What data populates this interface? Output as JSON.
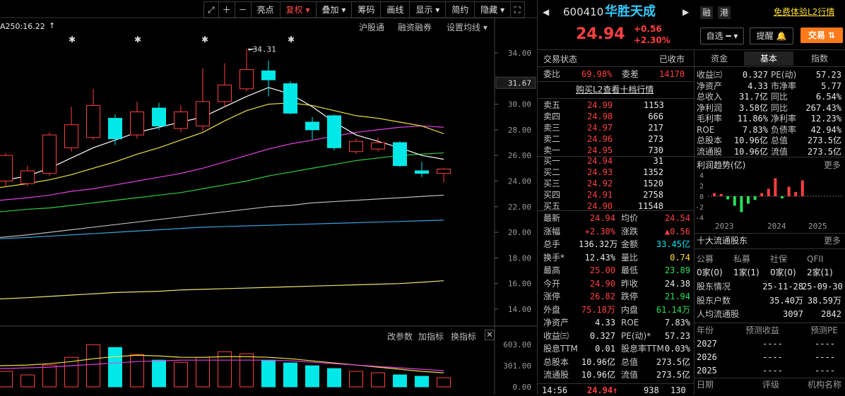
{
  "chart": {
    "ma_label": "A250:16.22",
    "toolbar": [
      "亮点",
      "复权",
      "叠加",
      "筹码",
      "画线",
      "显示",
      "简约",
      "隐藏"
    ],
    "toolbar_active": "复权",
    "links": [
      "沪股通",
      "融资融券",
      "设置均线"
    ],
    "peak_label": "34.31",
    "y_ticks": [
      "34.00",
      "30.00",
      "28.00",
      "26.00",
      "24.00",
      "22.00",
      "20.00",
      "18.00",
      "16.00",
      "14.00"
    ],
    "current_price_tag": "31.67",
    "vol_toolbar": [
      "改参数",
      "加指标",
      "换指标"
    ],
    "vol_ticks": [
      "603.00",
      "301.00",
      "0.00"
    ],
    "candles": [
      {
        "o": 24.0,
        "c": 26.0,
        "h": 26.2,
        "l": 23.6
      },
      {
        "o": 23.8,
        "c": 24.8,
        "h": 25.2,
        "l": 23.6
      },
      {
        "o": 24.6,
        "c": 27.6,
        "h": 27.8,
        "l": 24.4
      },
      {
        "o": 26.6,
        "c": 28.4,
        "h": 29.8,
        "l": 26.3
      },
      {
        "o": 27.4,
        "c": 29.9,
        "h": 31.2,
        "l": 27.2
      },
      {
        "o": 28.9,
        "c": 27.3,
        "h": 29.2,
        "l": 26.8
      },
      {
        "o": 27.6,
        "c": 29.4,
        "h": 30.2,
        "l": 27.3
      },
      {
        "o": 29.7,
        "c": 28.3,
        "h": 30.1,
        "l": 28.0
      },
      {
        "o": 28.1,
        "c": 29.4,
        "h": 29.9,
        "l": 27.8
      },
      {
        "o": 28.3,
        "c": 30.2,
        "h": 32.8,
        "l": 27.9
      },
      {
        "o": 30.2,
        "c": 31.5,
        "h": 33.2,
        "l": 29.8
      },
      {
        "o": 31.2,
        "c": 32.7,
        "h": 34.31,
        "l": 31.0
      },
      {
        "o": 32.6,
        "c": 31.9,
        "h": 33.4,
        "l": 30.6
      },
      {
        "o": 31.6,
        "c": 29.3,
        "h": 31.8,
        "l": 29.2
      },
      {
        "o": 28.6,
        "c": 28.0,
        "h": 29.0,
        "l": 27.2
      },
      {
        "o": 29.1,
        "c": 26.6,
        "h": 29.2,
        "l": 26.4
      },
      {
        "o": 26.3,
        "c": 27.1,
        "h": 27.3,
        "l": 26.1
      },
      {
        "o": 26.5,
        "c": 27.0,
        "h": 27.4,
        "l": 26.3
      },
      {
        "o": 27.0,
        "c": 25.2,
        "h": 27.1,
        "l": 25.1
      },
      {
        "o": 24.8,
        "c": 24.6,
        "h": 25.5,
        "l": 24.3
      },
      {
        "o": 24.6,
        "c": 24.94,
        "h": 25.0,
        "l": 23.89
      }
    ],
    "volumes": [
      220,
      170,
      310,
      420,
      600,
      560,
      460,
      380,
      350,
      420,
      500,
      470,
      380,
      340,
      300,
      260,
      220,
      200,
      170,
      150,
      130
    ],
    "ma_white": [
      24.0,
      24.4,
      25.0,
      25.8,
      26.6,
      27.2,
      27.8,
      28.2,
      28.6,
      29.0,
      29.8,
      30.6,
      31.3,
      30.8,
      29.8,
      28.6,
      27.6,
      27.1,
      26.6,
      26.0,
      25.7
    ],
    "ma_yellow": [
      23.5,
      23.8,
      24.1,
      24.5,
      25.0,
      25.5,
      26.1,
      26.6,
      27.2,
      27.8,
      28.7,
      29.5,
      30.0,
      30.1,
      29.9,
      29.5,
      29.1,
      28.9,
      28.6,
      28.3,
      27.7
    ],
    "ma_magenta": [
      22.5,
      22.7,
      22.9,
      23.2,
      23.4,
      23.7,
      24.0,
      24.3,
      24.6,
      25.0,
      25.5,
      26.0,
      26.5,
      26.9,
      27.2,
      27.5,
      27.8,
      28.0,
      28.2,
      28.3,
      28.2
    ],
    "ma_green": [
      21.6,
      21.8,
      21.9,
      22.1,
      22.3,
      22.5,
      22.7,
      22.9,
      23.1,
      23.4,
      23.7,
      24.0,
      24.4,
      24.7,
      25.0,
      25.3,
      25.6,
      25.8,
      26.0,
      26.1,
      26.2
    ],
    "ma_gray": [
      19.6,
      19.8,
      20.0,
      20.2,
      20.4,
      20.6,
      20.8,
      21.0,
      21.2,
      21.4,
      21.6,
      21.8,
      22.0,
      22.1,
      22.3,
      22.4,
      22.5,
      22.6,
      22.7,
      22.8,
      22.9
    ],
    "ma_blue": [
      19.5,
      19.6,
      19.7,
      19.8,
      19.9,
      20.0,
      20.1,
      20.2,
      20.3,
      20.4,
      20.45,
      20.5,
      20.55,
      20.6,
      20.65,
      20.7,
      20.75,
      20.8,
      20.85,
      20.9,
      20.95
    ],
    "ma_long": [
      14.8,
      14.9,
      15.0,
      15.1,
      15.2,
      15.3,
      15.35,
      15.4,
      15.5,
      15.55,
      15.6,
      15.65,
      15.7,
      15.75,
      15.8,
      15.85,
      15.9,
      15.95,
      16.0,
      16.1,
      16.22
    ],
    "vol_ma1": [
      300,
      310,
      330,
      360,
      400,
      430,
      450,
      440,
      420,
      420,
      430,
      430,
      420,
      400,
      370,
      340,
      310,
      280,
      250,
      220,
      200
    ],
    "vol_ma2": [
      260,
      270,
      280,
      300,
      320,
      340,
      360,
      370,
      380,
      380,
      380,
      380,
      380,
      370,
      350,
      330,
      310,
      290,
      270,
      250,
      230
    ]
  },
  "header": {
    "code": "600410",
    "name": "华胜天成",
    "tags": [
      "融",
      "港"
    ],
    "l2_link": "免费体验L2行情",
    "price": "24.94",
    "change": "+0.56",
    "change_pct": "+2.30%",
    "btn_select": "自选",
    "btn_alert": "提醒",
    "btn_trade": "交易"
  },
  "status": {
    "label": "交易状态",
    "value": "已收市"
  },
  "ratio": {
    "wb_label": "委比",
    "wb": "69.98%",
    "wc_label": "委差",
    "wc": "14170"
  },
  "l2_buy_link": "购买L2查看十档行情",
  "asks": [
    {
      "label": "卖五",
      "price": "24.99",
      "vol": "1153"
    },
    {
      "label": "卖四",
      "price": "24.98",
      "vol": "666"
    },
    {
      "label": "卖三",
      "price": "24.97",
      "vol": "217"
    },
    {
      "label": "卖二",
      "price": "24.96",
      "vol": "273"
    },
    {
      "label": "卖一",
      "price": "24.95",
      "vol": "730"
    }
  ],
  "bids": [
    {
      "label": "买一",
      "price": "24.94",
      "vol": "31"
    },
    {
      "label": "买二",
      "price": "24.93",
      "vol": "1352"
    },
    {
      "label": "买三",
      "price": "24.92",
      "vol": "1520"
    },
    {
      "label": "买四",
      "price": "24.91",
      "vol": "2758"
    },
    {
      "label": "买五",
      "price": "24.90",
      "vol": "11548"
    }
  ],
  "stats": [
    {
      "l1": "最新",
      "v1": "24.94",
      "c1": "red",
      "l2": "均价",
      "v2": "24.54",
      "c2": "red"
    },
    {
      "l1": "涨幅",
      "v1": "+2.30%",
      "c1": "red",
      "l2": "涨跌",
      "v2": "▲0.56",
      "c2": "red"
    },
    {
      "l1": "总手",
      "v1": "136.32万",
      "c1": "wht",
      "l2": "金额",
      "v2": "33.45亿",
      "c2": "cyan"
    },
    {
      "l1": "换手*",
      "v1": "12.43%",
      "c1": "wht",
      "l2": "量比",
      "v2": "0.74",
      "c2": "yel"
    },
    {
      "l1": "最高",
      "v1": "25.00",
      "c1": "red",
      "l2": "最低",
      "v2": "23.89",
      "c2": "grn"
    },
    {
      "l1": "今开",
      "v1": "24.90",
      "c1": "red",
      "l2": "昨收",
      "v2": "24.38",
      "c2": "wht"
    },
    {
      "l1": "涨停",
      "v1": "26.82",
      "c1": "red",
      "l2": "跌停",
      "v2": "21.94",
      "c2": "grn"
    },
    {
      "l1": "外盘",
      "v1": "75.18万",
      "c1": "red",
      "l2": "内盘",
      "v2": "61.14万",
      "c2": "grn"
    },
    {
      "l1": "净资产",
      "v1": "4.33",
      "c1": "wht",
      "l2": "ROE",
      "v2": "7.83%",
      "c2": "wht"
    },
    {
      "l1": "收益㈢",
      "v1": "0.327",
      "c1": "wht",
      "l2": "PE(动)*",
      "v2": "57.23",
      "c2": "wht"
    },
    {
      "l1": "股息TTM",
      "v1": "0.01",
      "c1": "wht",
      "l2": "股息率TTM",
      "v2": "0.03%",
      "c2": "wht"
    },
    {
      "l1": "总股本",
      "v1": "10.96亿",
      "c1": "wht",
      "l2": "总值",
      "v2": "273.5亿",
      "c2": "wht"
    },
    {
      "l1": "流通股",
      "v1": "10.96亿",
      "c1": "wht",
      "l2": "流值",
      "v2": "273.5亿",
      "c2": "wht"
    }
  ],
  "tick": {
    "time": "14:56",
    "price": "24.94",
    "arrow": "↑",
    "vol": "938",
    "count": "130"
  },
  "fund_tabs": [
    "资金",
    "基本",
    "指数"
  ],
  "fund_active": "基本",
  "fundamentals": [
    {
      "l1": "收益㈢",
      "v1": "0.327",
      "l2": "PE(动)",
      "v2": "57.23"
    },
    {
      "l1": "净资产",
      "v1": "4.33",
      "l2": "市净率",
      "v2": "5.77"
    },
    {
      "l1": "总收入",
      "v1": "31.7亿",
      "l2": "同比",
      "v2": "6.54%"
    },
    {
      "l1": "净利润",
      "v1": "3.58亿",
      "l2": "同比",
      "v2": "267.43%"
    },
    {
      "l1": "毛利率",
      "v1": "11.86%",
      "l2": "净利率",
      "v2": "12.23%"
    },
    {
      "l1": "ROE",
      "v1": "7.83%",
      "l2": "负债率",
      "v2": "42.94%"
    },
    {
      "l1": "总股本",
      "v1": "10.96亿",
      "l2": "总值",
      "v2": "273.5亿"
    },
    {
      "l1": "流通股",
      "v1": "10.96亿",
      "l2": "流值",
      "v2": "273.5亿"
    }
  ],
  "profit": {
    "title": "利润趋势(亿)",
    "more": "更多",
    "y_ticks": [
      "4",
      "2",
      "0",
      "-2",
      "-4"
    ],
    "years": [
      "2023",
      "2024",
      "2025"
    ],
    "bars": [
      0.6,
      0.4,
      -0.6,
      -1.8,
      -3.0,
      -1.4,
      -0.7,
      0.6,
      1.4,
      3.4,
      -0.4,
      1.8,
      0.8,
      3.0
    ]
  },
  "holders": {
    "title": "十大流通股东",
    "more": "更多",
    "cats": [
      "公募",
      "私募",
      "社保",
      "QFII"
    ],
    "counts": [
      "0家(0)",
      "1家(1)",
      "0家(0)",
      "2家(1)"
    ],
    "rows": [
      {
        "l": "股东情况",
        "a": "25-11-28",
        "b": "25-09-30"
      },
      {
        "l": "股东户数",
        "a": "35.40万",
        "b": "38.59万"
      },
      {
        "l": "人均流通股",
        "a": "3097",
        "b": "2842"
      }
    ]
  },
  "forecast": {
    "headers": [
      "年份",
      "预测收益",
      "预测PE"
    ],
    "rows": [
      {
        "year": "2027",
        "eps": "----",
        "pe": "----"
      },
      {
        "year": "2026",
        "eps": "----",
        "pe": "----"
      },
      {
        "year": "2025",
        "eps": "----",
        "pe": "----"
      }
    ]
  },
  "rating": {
    "a": "日期",
    "b": "评级",
    "c": "机构名称"
  }
}
